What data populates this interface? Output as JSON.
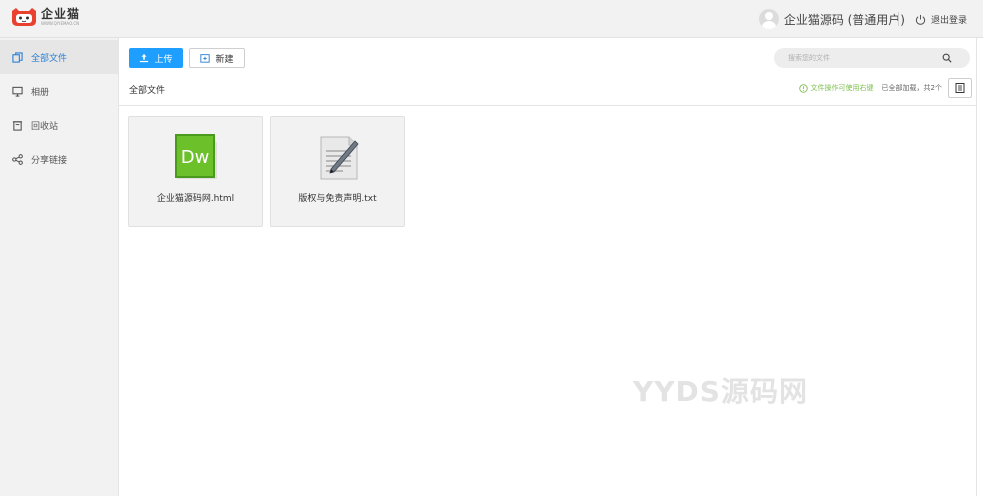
{
  "header": {
    "logo_name": "企业猫",
    "logo_sub": "WWW.QIYEMAO.CN",
    "user_name": "企业猫源码 (普通用户)",
    "logout_label": "退出登录"
  },
  "sidebar": {
    "items": [
      {
        "label": "全部文件",
        "icon": "files-icon",
        "active": true
      },
      {
        "label": "相册",
        "icon": "monitor-icon",
        "active": false
      },
      {
        "label": "回收站",
        "icon": "trash-icon",
        "active": false
      },
      {
        "label": "分享链接",
        "icon": "share-icon",
        "active": false
      }
    ]
  },
  "toolbar": {
    "upload_label": "上传",
    "new_label": "新建",
    "search_placeholder": "搜索您的文件"
  },
  "main": {
    "breadcrumb": "全部文件",
    "tip": "文件操作可使用右键",
    "loaded_text": "已全部加载，共2个"
  },
  "files": [
    {
      "name": "企业猫源码网.html",
      "icon": "dreamweaver-file-icon"
    },
    {
      "name": "版权与免责声明.txt",
      "icon": "text-file-icon"
    }
  ],
  "watermark": "YYDS源码网",
  "colors": {
    "accent": "#1e9fff",
    "tip": "#7cbf4f",
    "active_sidebar_text": "#2a7fd4"
  }
}
